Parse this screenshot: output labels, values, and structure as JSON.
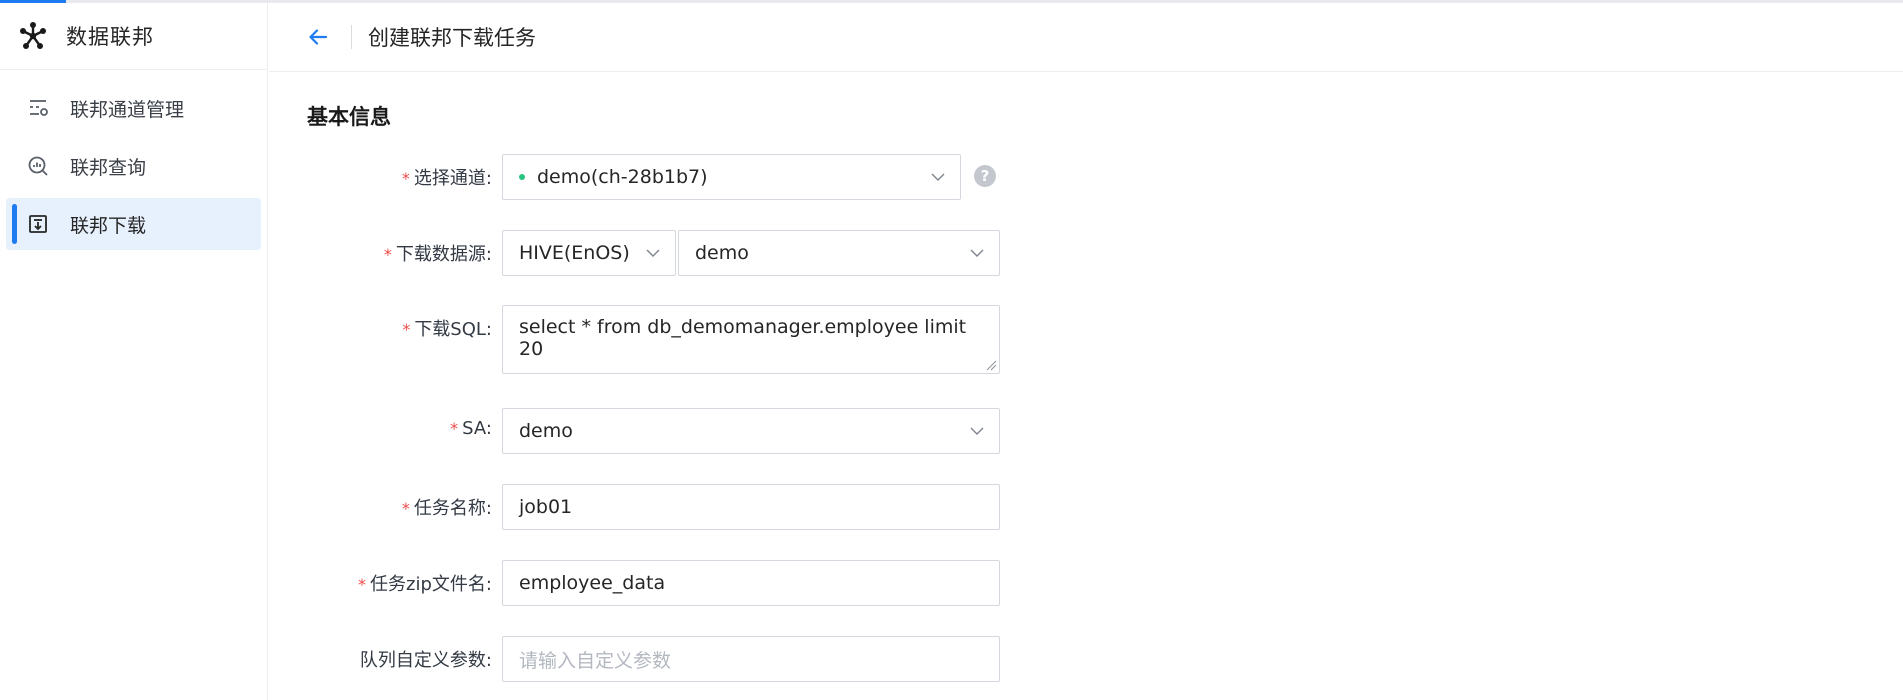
{
  "app": {
    "title": "数据联邦"
  },
  "sidebar": {
    "items": [
      {
        "label": "联邦通道管理",
        "icon": "channel-manage-icon"
      },
      {
        "label": "联邦查询",
        "icon": "query-search-icon"
      },
      {
        "label": "联邦下载",
        "icon": "download-icon",
        "active": true
      }
    ]
  },
  "header": {
    "title": "创建联邦下载任务",
    "back_icon": "arrow-left-icon"
  },
  "form": {
    "section_title": "基本信息",
    "required_mark": "*",
    "channel": {
      "label": "选择通道:",
      "value": "demo(ch-28b1b7)",
      "status_color": "#29c27f"
    },
    "datasource": {
      "label": "下载数据源:",
      "type_value": "HIVE(EnOS)",
      "source_value": "demo"
    },
    "sql": {
      "label": "下载SQL:",
      "value": "select * from db_demomanager.employee limit 20"
    },
    "sa": {
      "label": "SA:",
      "value": "demo"
    },
    "task_name": {
      "label": "任务名称:",
      "value": "job01"
    },
    "zip_name": {
      "label": "任务zip文件名:",
      "value": "employee_data"
    },
    "queue_params": {
      "label": "队列自定义参数:",
      "placeholder": "请输入自定义参数"
    }
  },
  "colors": {
    "accent": "#1f7bf0",
    "required": "#f04a4a",
    "active_bg": "#e7f1fe"
  }
}
